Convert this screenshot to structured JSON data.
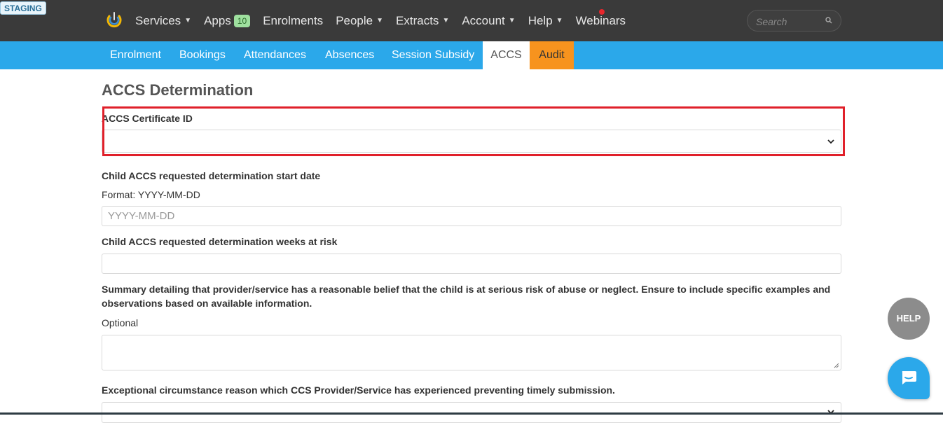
{
  "env_badge": "STAGING",
  "nav": {
    "items": [
      {
        "label": "Services",
        "caret": true
      },
      {
        "label": "Apps",
        "badge": "10"
      },
      {
        "label": "Enrolments"
      },
      {
        "label": "People",
        "caret": true
      },
      {
        "label": "Extracts",
        "caret": true
      },
      {
        "label": "Account",
        "caret": true
      },
      {
        "label": "Help",
        "caret": true
      },
      {
        "label": "Webinars"
      }
    ],
    "search_placeholder": "Search"
  },
  "subnav": {
    "tabs": [
      "Enrolment",
      "Bookings",
      "Attendances",
      "Absences",
      "Session Subsidy",
      "ACCS",
      "Audit"
    ],
    "active": "ACCS"
  },
  "page": {
    "title": "ACCS Determination",
    "certificate_label": "ACCS Certificate ID",
    "certificate_value": "",
    "start_date_label": "Child ACCS requested determination start date",
    "start_date_hint": "Format: YYYY-MM-DD",
    "start_date_placeholder": "YYYY-MM-DD",
    "weeks_label": "Child ACCS requested determination weeks at risk",
    "summary_label_line1": "Summary detailing that provider/service has a reasonable belief that the child is at serious risk of abuse or neglect. Ensure to include specific examples and",
    "summary_label_line2": "observations based on available information.",
    "summary_hint": "Optional",
    "exceptional_label": "Exceptional circumstance reason which CCS Provider/Service has experienced preventing timely submission."
  },
  "floating": {
    "help_label": "HELP"
  },
  "colors": {
    "topbar": "#3a3a3a",
    "subnav": "#2ba8ea",
    "audit_tab": "#f7931e",
    "highlight": "#e0202a"
  }
}
